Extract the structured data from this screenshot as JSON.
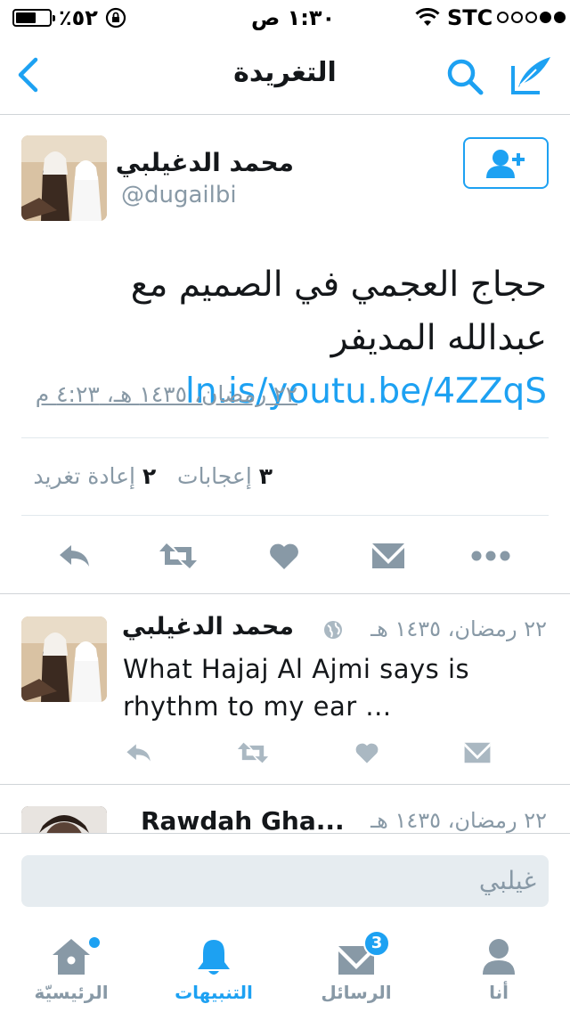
{
  "status_bar": {
    "battery": "٪٥٢",
    "time": "١:٣٠ ص",
    "carrier": "STC"
  },
  "nav": {
    "title": "التغريدة"
  },
  "tweet": {
    "author_name": "محمد الدغيلبي",
    "handle": "@dugailbi",
    "text": "حجاج العجمي في الصميم مع عبدالله المديفر",
    "link": "ln.is/youtu.be/4ZZqS",
    "timestamp": "٢٢ رمضان، ١٤٣٥ هـ، ٤:٢٣ م",
    "likes_count": "٣",
    "likes_label": "إعجابات",
    "retweets_count": "٢",
    "retweets_label": "إعادة تغريد"
  },
  "replies": [
    {
      "author_name": "محمد الدغيلبي",
      "date": "٢٢ رمضان، ١٤٣٥ هـ",
      "text": "What Hajaj Al Ajmi says is rhythm to my ear ..."
    },
    {
      "author_name": "Rawdah Gha...",
      "date": "٢٢ رمضان، ١٤٣٥ هـ"
    }
  ],
  "composer": {
    "placeholder": "غيلبي"
  },
  "tabs": [
    {
      "label": "الرئيسيّة",
      "icon": "home-icon"
    },
    {
      "label": "التنبيهات",
      "icon": "bell-icon"
    },
    {
      "label": "الرسائل",
      "icon": "envelope-icon",
      "badge": "3"
    },
    {
      "label": "أنا",
      "icon": "person-icon"
    }
  ],
  "colors": {
    "accent": "#1da1f2",
    "muted": "#8899a6",
    "text": "#14171a"
  }
}
